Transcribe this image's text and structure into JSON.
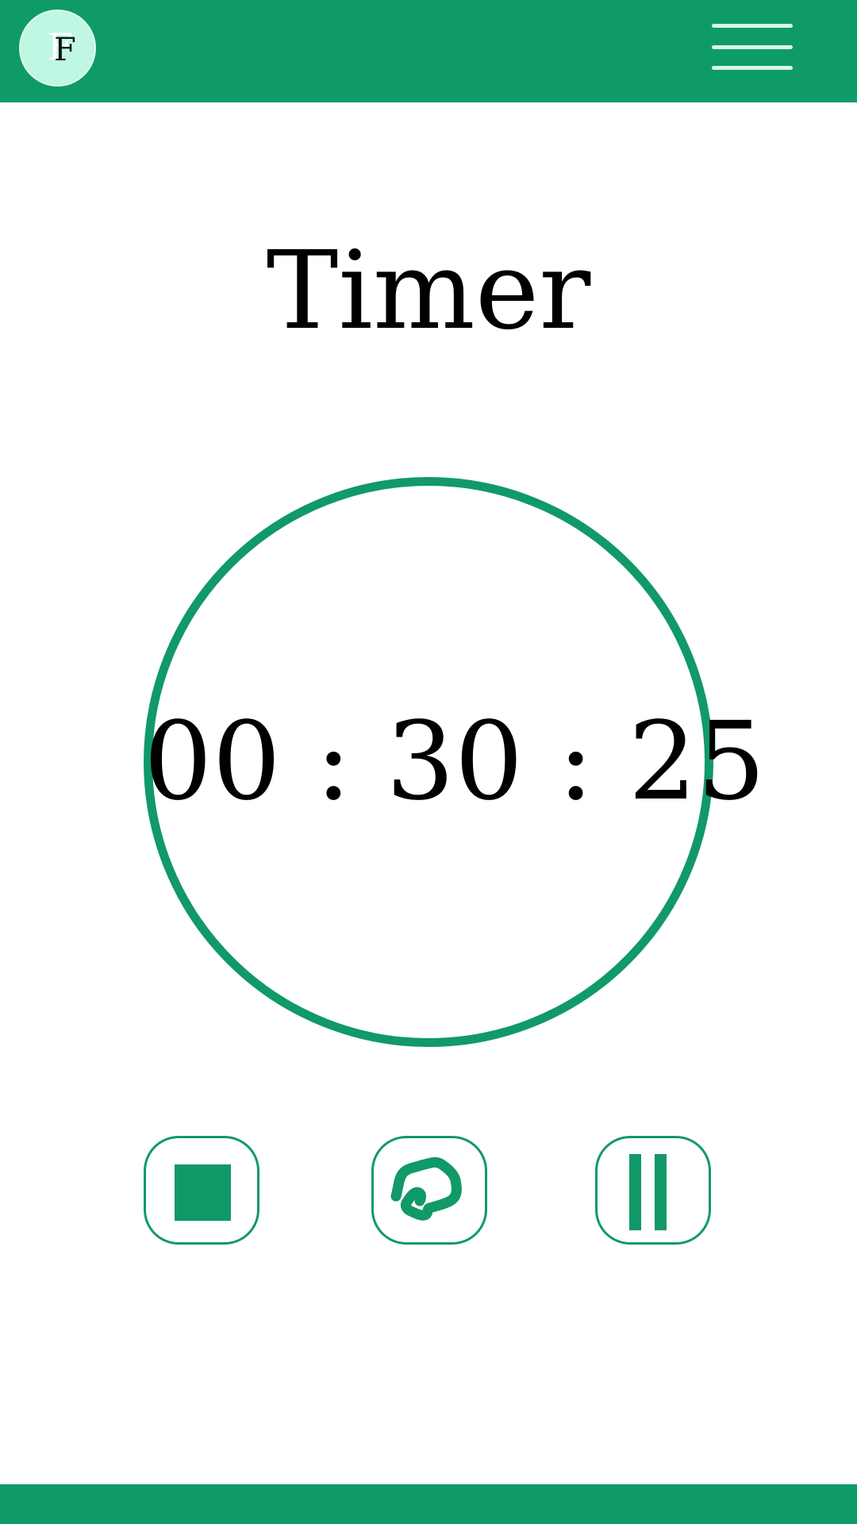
{
  "colors": {
    "primary": "#0f9b68",
    "accent_light": "#c0f7e2",
    "text": "#000000",
    "background": "#ffffff"
  },
  "header": {
    "avatar_letter": "F",
    "menu_icon": "hamburger-menu-icon"
  },
  "main": {
    "title": "Timer",
    "timer": {
      "display": "00 : 30 : 25"
    }
  },
  "controls": [
    {
      "name": "stop",
      "icon": "stop-icon"
    },
    {
      "name": "reset",
      "icon": "reset-icon"
    },
    {
      "name": "pause",
      "icon": "pause-icon"
    }
  ]
}
